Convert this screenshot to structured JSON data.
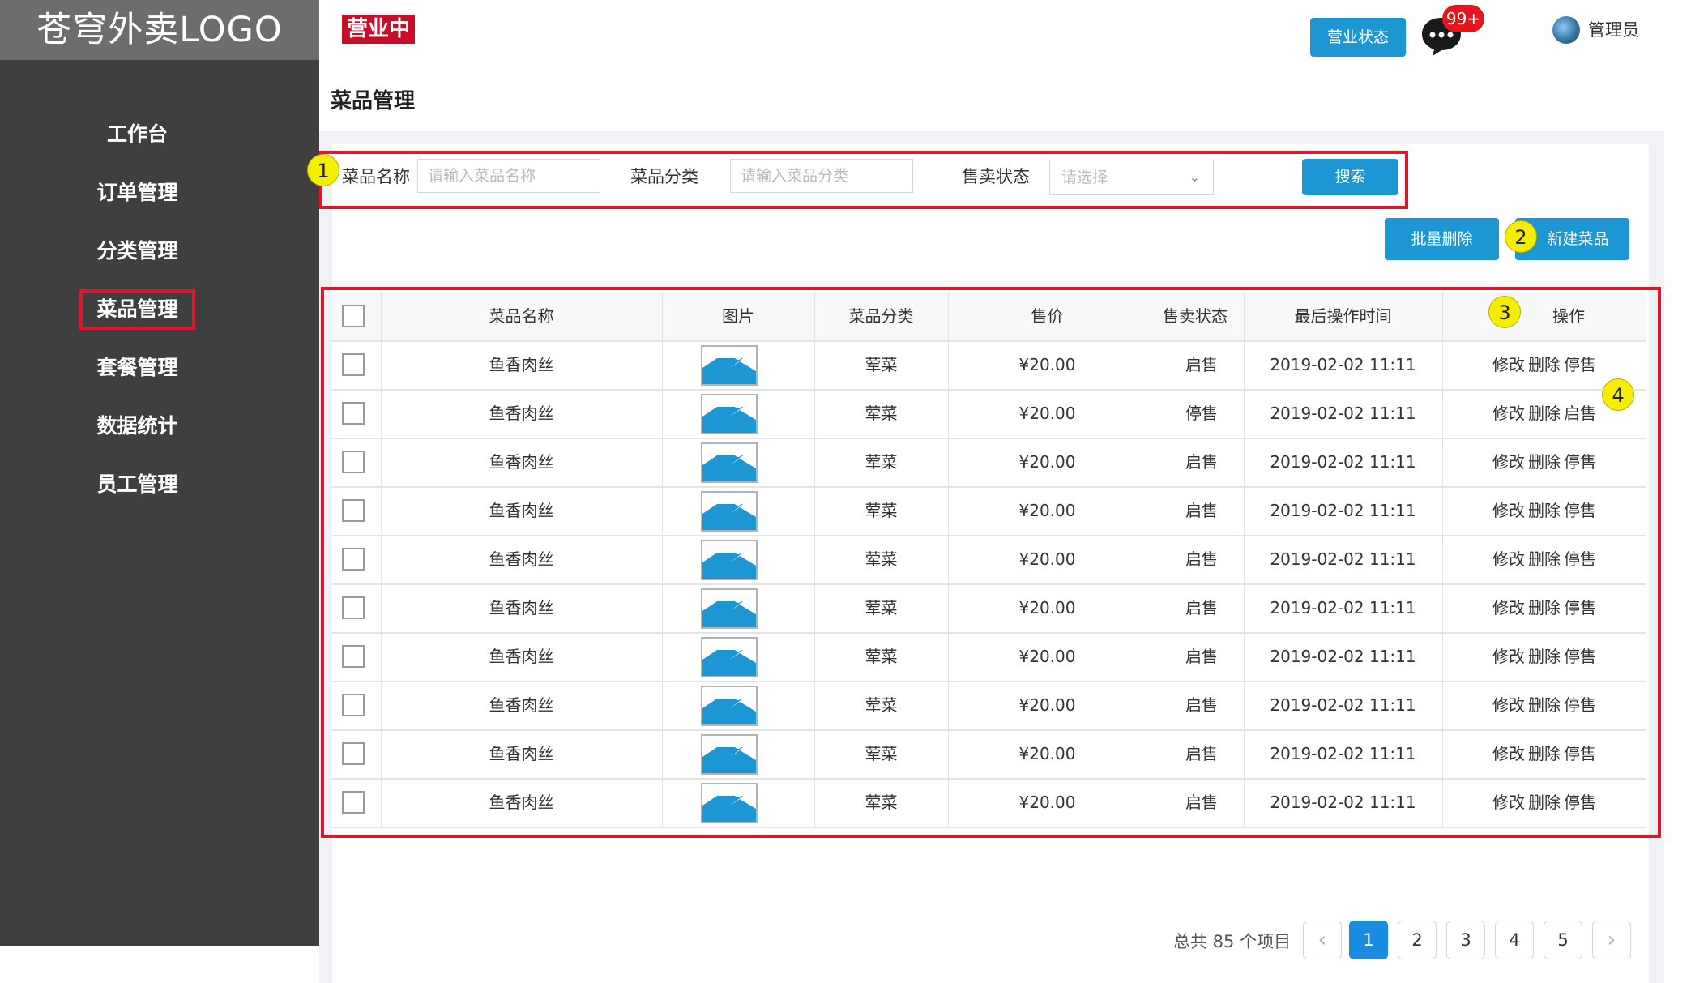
{
  "sidebar": {
    "logo": "苍穹外卖LOGO",
    "items": [
      {
        "label": "工作台"
      },
      {
        "label": "订单管理"
      },
      {
        "label": "分类管理"
      },
      {
        "label": "菜品管理",
        "active": true
      },
      {
        "label": "套餐管理"
      },
      {
        "label": "数据统计"
      },
      {
        "label": "员工管理"
      }
    ]
  },
  "header": {
    "status_badge": "营业中",
    "biz_status_button": "营业状态",
    "message_count": "99+",
    "user_name": "管理员"
  },
  "page": {
    "title": "菜品管理"
  },
  "annotations": [
    "1",
    "2",
    "3",
    "4"
  ],
  "search": {
    "name_label": "菜品名称",
    "name_placeholder": "请输入菜品名称",
    "category_label": "菜品分类",
    "category_placeholder": "请输入菜品分类",
    "status_label": "售卖状态",
    "status_placeholder": "请选择",
    "search_button": "搜索"
  },
  "actions": {
    "batch_delete": "批量删除",
    "new_dish": "新建菜品"
  },
  "table": {
    "headers": [
      "菜品名称",
      "图片",
      "菜品分类",
      "售价",
      "售卖状态",
      "最后操作时间",
      "操作"
    ],
    "rows": [
      {
        "name": "鱼香肉丝",
        "category": "荤菜",
        "price": "¥20.00",
        "status": "启售",
        "time": "2019-02-02 11:11",
        "edit": "修改",
        "del": "删除",
        "toggle": "停售"
      },
      {
        "name": "鱼香肉丝",
        "category": "荤菜",
        "price": "¥20.00",
        "status": "停售",
        "time": "2019-02-02 11:11",
        "edit": "修改",
        "del": "删除",
        "toggle": "启售"
      },
      {
        "name": "鱼香肉丝",
        "category": "荤菜",
        "price": "¥20.00",
        "status": "启售",
        "time": "2019-02-02 11:11",
        "edit": "修改",
        "del": "删除",
        "toggle": "停售"
      },
      {
        "name": "鱼香肉丝",
        "category": "荤菜",
        "price": "¥20.00",
        "status": "启售",
        "time": "2019-02-02 11:11",
        "edit": "修改",
        "del": "删除",
        "toggle": "停售"
      },
      {
        "name": "鱼香肉丝",
        "category": "荤菜",
        "price": "¥20.00",
        "status": "启售",
        "time": "2019-02-02 11:11",
        "edit": "修改",
        "del": "删除",
        "toggle": "停售"
      },
      {
        "name": "鱼香肉丝",
        "category": "荤菜",
        "price": "¥20.00",
        "status": "启售",
        "time": "2019-02-02 11:11",
        "edit": "修改",
        "del": "删除",
        "toggle": "停售"
      },
      {
        "name": "鱼香肉丝",
        "category": "荤菜",
        "price": "¥20.00",
        "status": "启售",
        "time": "2019-02-02 11:11",
        "edit": "修改",
        "del": "删除",
        "toggle": "停售"
      },
      {
        "name": "鱼香肉丝",
        "category": "荤菜",
        "price": "¥20.00",
        "status": "启售",
        "time": "2019-02-02 11:11",
        "edit": "修改",
        "del": "删除",
        "toggle": "停售"
      },
      {
        "name": "鱼香肉丝",
        "category": "荤菜",
        "price": "¥20.00",
        "status": "启售",
        "time": "2019-02-02 11:11",
        "edit": "修改",
        "del": "删除",
        "toggle": "停售"
      },
      {
        "name": "鱼香肉丝",
        "category": "荤菜",
        "price": "¥20.00",
        "status": "启售",
        "time": "2019-02-02 11:11",
        "edit": "修改",
        "del": "删除",
        "toggle": "停售"
      }
    ]
  },
  "pagination": {
    "total_text": "总共 85 个项目",
    "pages": [
      "1",
      "2",
      "3",
      "4",
      "5"
    ],
    "current": "1",
    "prev_icon": "‹",
    "next_icon": "›"
  },
  "colors": {
    "primary": "#1d96d4",
    "highlight": "#e1152b",
    "sidebar": "#3f3f3f",
    "annotation": "#f5ee00"
  },
  "icons": {
    "message": "chat-bubble-icon",
    "image": "image-placeholder-icon",
    "dropdown": "chevron-down-icon"
  }
}
